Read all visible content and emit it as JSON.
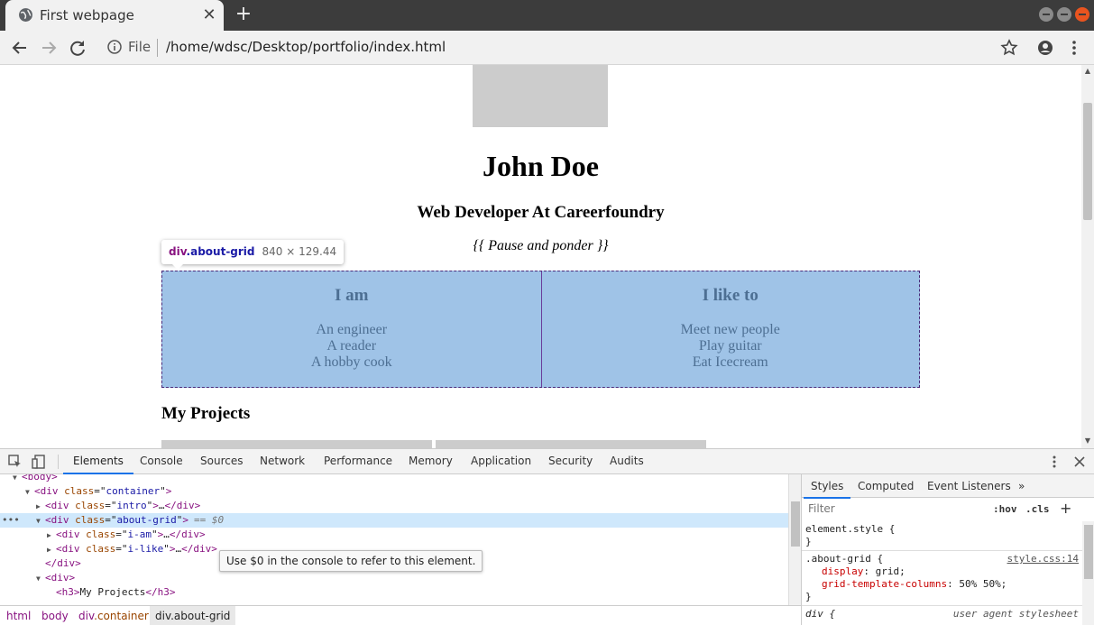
{
  "browser": {
    "tab_title": "First webpage",
    "url_scheme": "File",
    "url": "/home/wdsc/Desktop/portfolio/index.html"
  },
  "page": {
    "name": "John Doe",
    "role": "Web Developer At Careerfoundry",
    "quote": "{{ Pause and ponder }}",
    "about_grid": {
      "left_title": "I am",
      "left_items": [
        "An engineer",
        "A reader",
        "A hobby cook"
      ],
      "right_title": "I like to",
      "right_items": [
        "Meet new people",
        "Play guitar",
        "Eat Icecream"
      ]
    },
    "projects_heading": "My Projects"
  },
  "inspect_tooltip": {
    "tag": "div",
    "class": ".about-grid",
    "dims": "840 × 129.44"
  },
  "devtools": {
    "tabs": [
      "Elements",
      "Console",
      "Sources",
      "Network",
      "Performance",
      "Memory",
      "Application",
      "Security",
      "Audits"
    ],
    "active_tab": "Elements",
    "dom": {
      "body": "body",
      "container_tag": "div",
      "container_attr": "class",
      "container_val": "container",
      "intro_val": "intro",
      "aboutgrid_val": "about-grid",
      "selected_marker": "== $0",
      "iam_val": "i-am",
      "ilike_val": "i-like",
      "close_div": "/div",
      "div": "div",
      "h3": "h3",
      "h3_text": "My Projects",
      "ellipsis": "…"
    },
    "console_tip": "Use $0 in the console to refer to this element.",
    "breadcrumbs": [
      "html",
      "body",
      "div",
      ".container",
      "div.about-grid"
    ],
    "styles_tabs": [
      "Styles",
      "Computed",
      "Event Listeners"
    ],
    "styles_more": "»",
    "filter_placeholder": "Filter",
    "hov_label": ":hov",
    "cls_label": ".cls",
    "plus_label": "+",
    "rules": {
      "element_style_sel": "element.style {",
      "close_brace": "}",
      "grid_sel": ".about-grid {",
      "grid_src": "style.css:14",
      "prop1": "display",
      "val1": "grid;",
      "prop2": "grid-template-columns",
      "val2": "50% 50%;",
      "ua_sel": "div {",
      "ua_src": "user agent stylesheet"
    }
  },
  "colors": {
    "grid_bg": "#9fc3e7",
    "grid_text": "#4d6f93",
    "tab_active_underline": "#1a73e8"
  }
}
